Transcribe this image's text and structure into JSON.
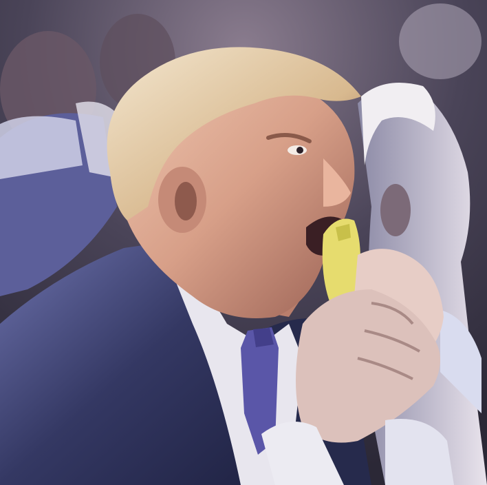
{
  "image": {
    "style": "painterly posterized photo",
    "palette": {
      "background_dark": "#3a3546",
      "crowd_blue": "#5c5f9a",
      "suit_navy": "#2b2f55",
      "shirt_white": "#e8e6ee",
      "tie_purple": "#5a56a8",
      "skin": "#d9a48e",
      "skin_shadow": "#9c6a5c",
      "hair_blond": "#e7d3b3",
      "food_yellow": "#e6dc6e"
    }
  }
}
